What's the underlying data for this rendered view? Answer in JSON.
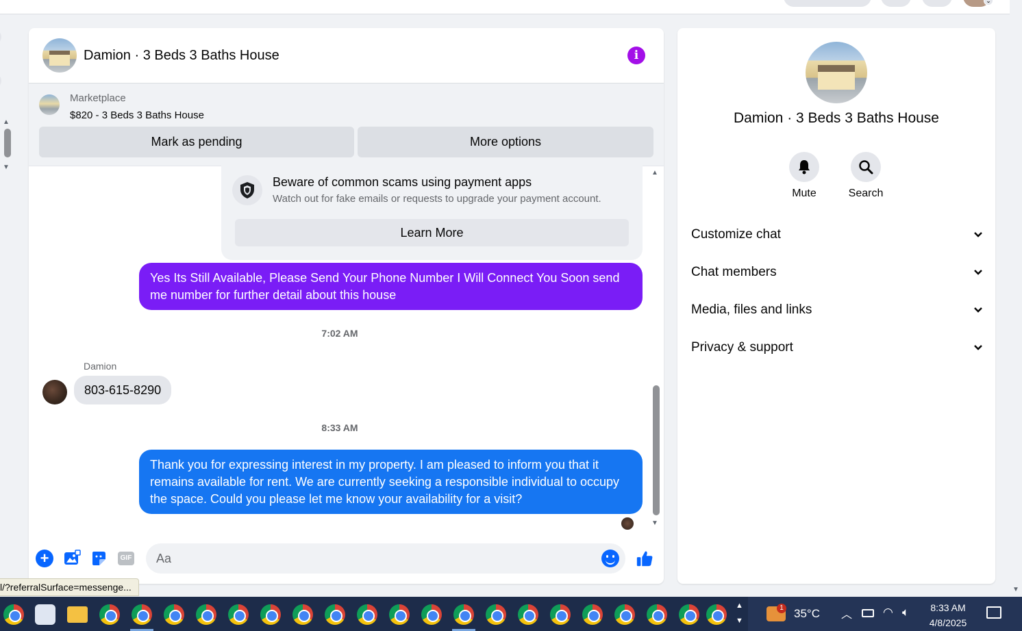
{
  "browser": {
    "status_url": "l/?referralSurface=messenge..."
  },
  "chat": {
    "title": "Damion · 3 Beds 3 Baths House",
    "marketplace": {
      "label": "Marketplace",
      "listing": "$820 - 3 Beds 3 Baths House",
      "mark_pending": "Mark as pending",
      "more_options": "More options"
    },
    "scam_notice": {
      "title": "Beware of common scams using payment apps",
      "subtitle": "Watch out for fake emails or requests to upgrade your payment account.",
      "button": "Learn More"
    },
    "messages": [
      {
        "direction": "outgoing",
        "text": "Yes Its Still Available, Please Send Your Phone Number I Will Connect You Soon send me number for further detail about this house",
        "color": "#7a1df6"
      },
      {
        "type": "timestamp",
        "text": "7:02 AM"
      },
      {
        "direction": "incoming",
        "sender": "Damion",
        "text": "803-615-8290"
      },
      {
        "type": "timestamp",
        "text": "8:33 AM"
      },
      {
        "direction": "outgoing",
        "text": "Thank you for expressing interest in my property. I am pleased to inform you that it remains available for rent. We are currently seeking a responsible individual to occupy the space. Could you please let me know your availability for a visit?",
        "color": "#1676f2"
      }
    ],
    "composer": {
      "placeholder": "Aa",
      "gif_label": "GIF"
    }
  },
  "info_panel": {
    "name": "Damion · 3 Beds 3 Baths House",
    "actions": [
      {
        "label": "Mute",
        "icon": "bell-icon"
      },
      {
        "label": "Search",
        "icon": "search-icon"
      }
    ],
    "sections": [
      "Customize chat",
      "Chat members",
      "Media, files and links",
      "Privacy & support"
    ]
  },
  "taskbar": {
    "weather": "35°C",
    "weather_badge": "1",
    "time": "8:33 AM",
    "date": "4/8/2025"
  },
  "colors": {
    "accent": "#0866ff",
    "info_icon": "#a30fe8"
  }
}
